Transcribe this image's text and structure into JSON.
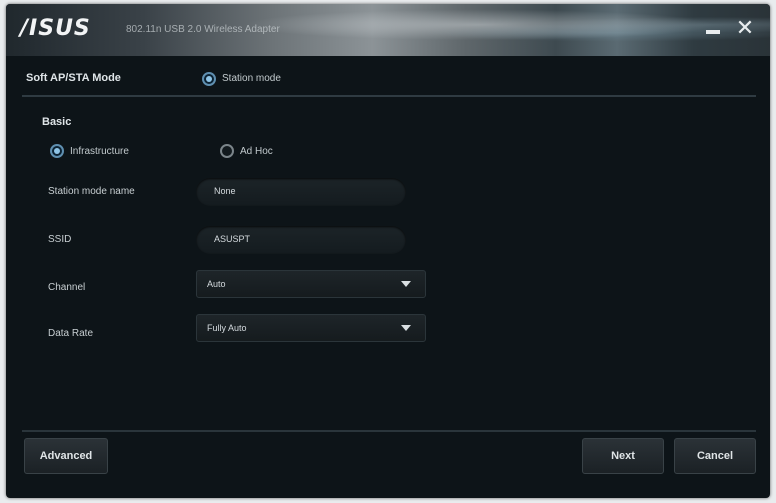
{
  "window": {
    "logo": "/ISUS",
    "title": "802.11n USB 2.0 Wireless Adapter",
    "minimize_icon": "minimize-icon",
    "close_icon": "close-icon",
    "close_glyph": "✕"
  },
  "mode": {
    "label": "Soft AP/STA Mode",
    "option_label": "Station mode",
    "option_selected": true
  },
  "basic": {
    "title": "Basic",
    "network_types": [
      {
        "label": "Infrastructure",
        "selected": true
      },
      {
        "label": "Ad Hoc",
        "selected": false
      }
    ],
    "fields": {
      "station_name_label": "Station mode name",
      "station_name_value": "None",
      "ssid_label": "SSID",
      "ssid_value": "ASUSPT",
      "channel_label": "Channel",
      "channel_value": "Auto",
      "data_rate_label": "Data Rate",
      "data_rate_value": "Fully Auto"
    }
  },
  "footer": {
    "advanced_label": "Advanced",
    "next_label": "Next",
    "cancel_label": "Cancel"
  },
  "colors": {
    "background": "#0d1418",
    "accent_radio": "#5f8fb0",
    "text": "#dfe5e8"
  }
}
